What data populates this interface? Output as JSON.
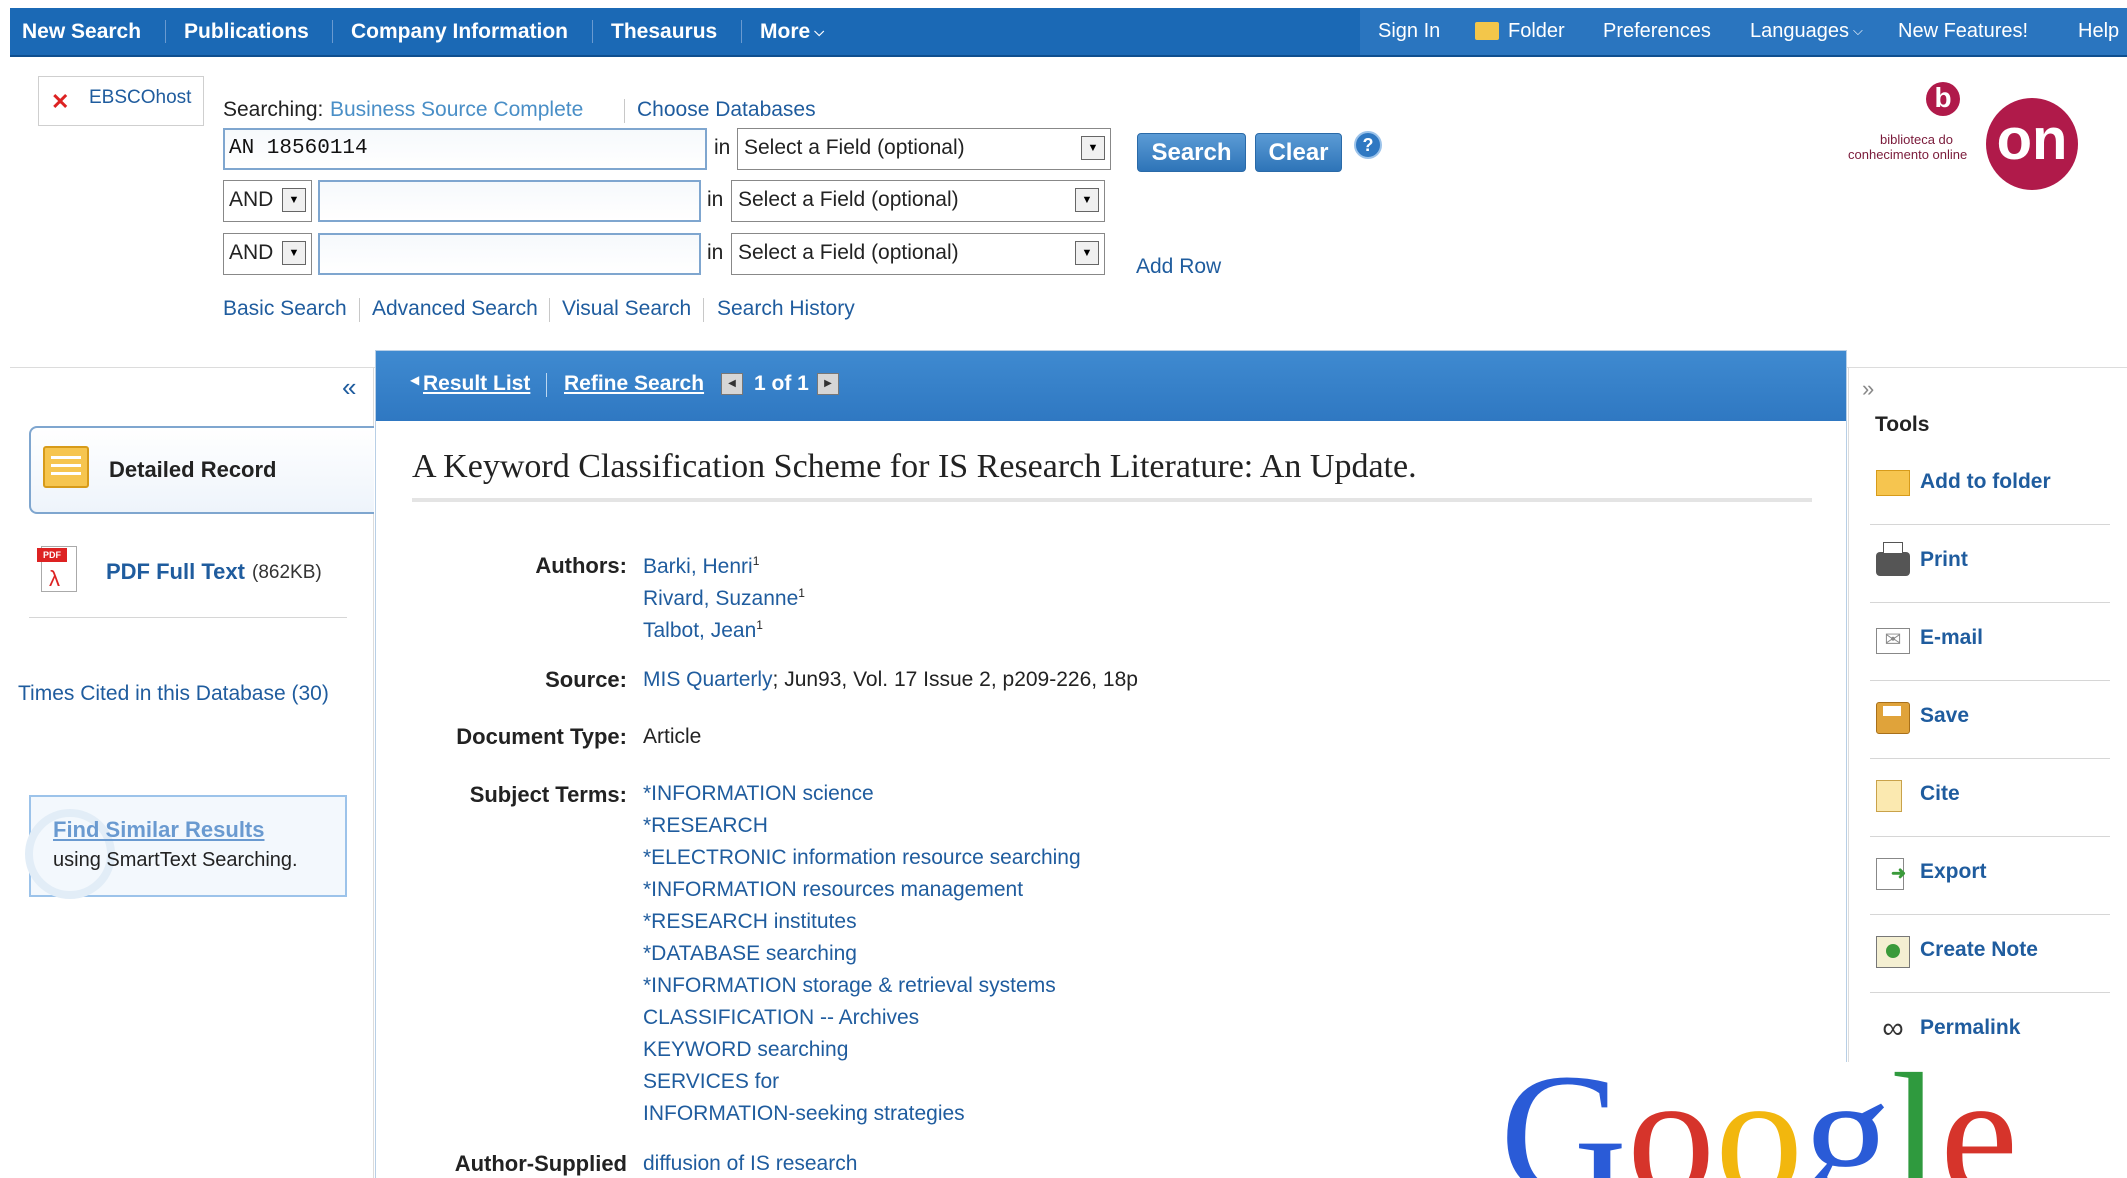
{
  "nav": {
    "left": [
      "New Search",
      "Publications",
      "Company Information",
      "Thesaurus",
      "More"
    ],
    "right": [
      "Sign In",
      "Folder",
      "Preferences",
      "Languages",
      "New Features!",
      "Help"
    ]
  },
  "ebsco": {
    "label": "EBSCOhost"
  },
  "search": {
    "searching_label": "Searching:",
    "database": "Business Source Complete",
    "choose_databases": "Choose Databases",
    "in": "in",
    "rows": [
      {
        "op": "",
        "value": "AN 18560114",
        "field": "Select a Field (optional)"
      },
      {
        "op": "AND",
        "value": "",
        "field": "Select a Field (optional)"
      },
      {
        "op": "AND",
        "value": "",
        "field": "Select a Field (optional)"
      }
    ],
    "search_button": "Search",
    "clear_button": "Clear",
    "help": "?",
    "add_row": "Add Row",
    "links": [
      "Basic Search",
      "Advanced Search",
      "Visual Search",
      "Search History"
    ]
  },
  "logo": {
    "text1": "biblioteca do",
    "text2": "conhecimento online",
    "mark": "on",
    "b": "b"
  },
  "left": {
    "collapse": "«",
    "detailed_record": "Detailed Record",
    "pdf_label": "PDF Full Text",
    "pdf_size": "(862KB)",
    "times_cited": "Times Cited in this Database (30)",
    "find_similar": "Find Similar Results",
    "find_similar_sub": "using SmartText Searching."
  },
  "center": {
    "result_list": "Result List",
    "refine_search": "Refine Search",
    "pager": "1 of 1",
    "title": "A Keyword Classification Scheme for IS Research Literature: An Update.",
    "authors_label": "Authors:",
    "authors": [
      "Barki, Henri",
      "Rivard, Suzanne",
      "Talbot, Jean"
    ],
    "sup": "1",
    "source_label": "Source:",
    "source_link": "MIS Quarterly",
    "source_rest": "; Jun93, Vol. 17 Issue 2, p209-226, 18p",
    "doctype_label": "Document Type:",
    "doctype": "Article",
    "subjects_label": "Subject Terms:",
    "subjects": [
      "*INFORMATION science",
      "*RESEARCH",
      "*ELECTRONIC information resource searching",
      "*INFORMATION resources management",
      "*RESEARCH institutes",
      "*DATABASE searching",
      "*INFORMATION storage & retrieval systems",
      "CLASSIFICATION -- Archives",
      "KEYWORD searching",
      "SERVICES for",
      "INFORMATION-seeking strategies"
    ],
    "author_supplied_label": "Author-Supplied",
    "author_supplied": "diffusion of IS research"
  },
  "right": {
    "expand": "»",
    "tools_title": "Tools",
    "tools": [
      "Add to folder",
      "Print",
      "E-mail",
      "Save",
      "Cite",
      "Export",
      "Create Note",
      "Permalink"
    ]
  },
  "google": {
    "text": "Google"
  },
  "colors": {
    "nav_bg": "#1b69b5",
    "link": "#1f5c9e",
    "header_bg": "#2f78c2"
  }
}
